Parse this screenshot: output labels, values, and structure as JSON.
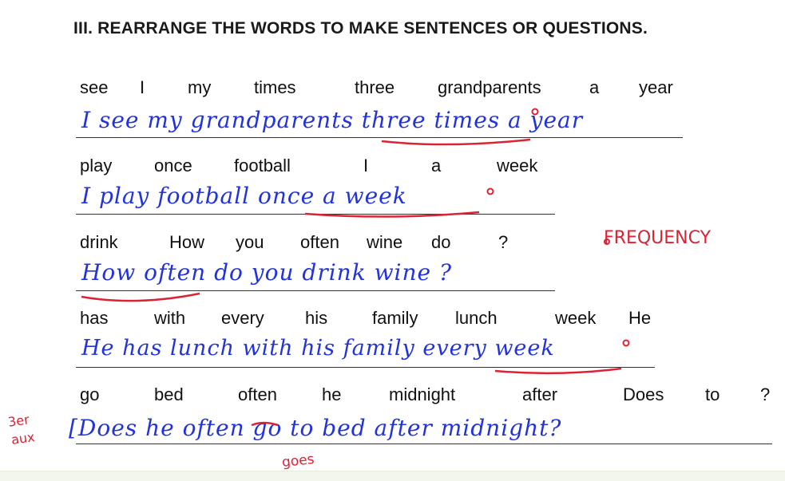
{
  "heading": "III. REARRANGE THE WORDS TO MAKE SENTENCES OR QUESTIONS.",
  "exercises": [
    {
      "words": [
        "see",
        "I",
        "my",
        "times",
        "three",
        "grandparents",
        "a",
        "year"
      ],
      "answer": "I see my grandparents three times a year"
    },
    {
      "words": [
        "play",
        "once",
        "football",
        "I",
        "a",
        "week"
      ],
      "answer": "I play football once a week"
    },
    {
      "words": [
        "drink",
        "How",
        "you",
        "often",
        "wine",
        "do",
        "?"
      ],
      "answer": "How often do you drink wine ?"
    },
    {
      "words": [
        "has",
        "with",
        "every",
        "his",
        "family",
        "lunch",
        "week",
        "He"
      ],
      "answer": "He has lunch with his family every week"
    },
    {
      "words": [
        "go",
        "bed",
        "often",
        "he",
        "midnight",
        "after",
        "Does",
        "to",
        "?"
      ],
      "answer": "[Does he often go to bed after midnight?"
    }
  ],
  "annotations": {
    "frequency_note": "FREQUENCY",
    "margin_note_line1": "3er",
    "margin_note_line2": "aux",
    "correction": "goes",
    "ink_blue": "#2233dd",
    "ink_red": "#dd2233"
  }
}
